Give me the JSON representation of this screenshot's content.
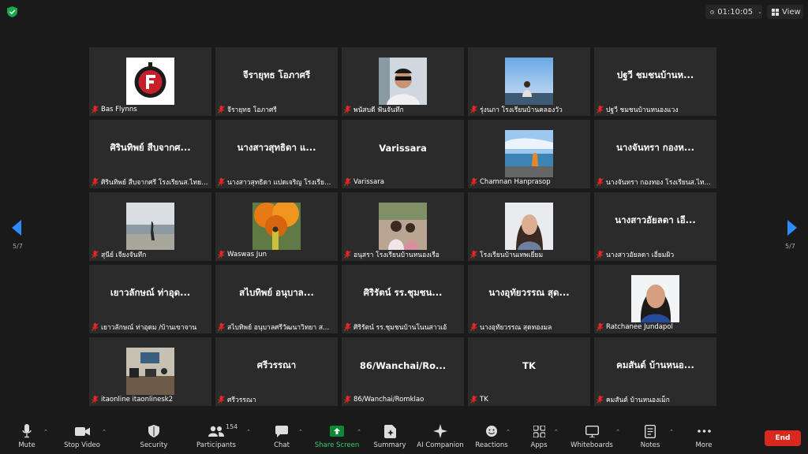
{
  "meeting": {
    "timer": "01:10:05",
    "view_label": "View",
    "page_indicator_left": "5/7",
    "page_indicator_right": "5/7",
    "accent_green": "#0e8a37",
    "mic_off_red": "#e02828"
  },
  "tiles": [
    {
      "big": "",
      "label": "Bas Flynns",
      "photo": "logo"
    },
    {
      "big": "จีรายุทธ โอภาศรี",
      "label": "จีรายุทธ โอภาศรี",
      "photo": ""
    },
    {
      "big": "",
      "label": "พนัสบดี ฟันจันทึก",
      "photo": "man"
    },
    {
      "big": "",
      "label": "รุ่งนภา โรงเรียนบ้านคลองวัว",
      "photo": "sky"
    },
    {
      "big": "ปฐวี ชมชนบ้านห...",
      "label": "ปฐวี ชมชนบ้านหนองแวง",
      "photo": ""
    },
    {
      "big": "ศิรินทิพย์ สืบจากศ...",
      "label": "ศิรินทิพย์ สืบจากศรี โรงเรียนส.ไทยเ...",
      "photo": ""
    },
    {
      "big": "นางสาวสุทธิดา แ...",
      "label": "นางสาวสุทธิดา แปดเจริญ โรงเรียน...",
      "photo": ""
    },
    {
      "big": "Varissara",
      "label": "Varissara",
      "photo": ""
    },
    {
      "big": "",
      "label": "Chamnan Hanprasop",
      "photo": "sea"
    },
    {
      "big": "นางจันทรา กองห...",
      "label": "นางจันทรา กองทอง โรงเรียนส.ไทยเ...",
      "photo": ""
    },
    {
      "big": "",
      "label": "สุนีย์ เจียงจันทึก",
      "photo": "lake"
    },
    {
      "big": "",
      "label": "Waswas Jun",
      "photo": "tree"
    },
    {
      "big": "",
      "label": "อนุสรา โรงเรียนบ้านหนองเรือ",
      "photo": "kids"
    },
    {
      "big": "",
      "label": "โรงเรียนบ้านเทพเยี่ยม",
      "photo": "woman"
    },
    {
      "big": "นางสาวอัยลดา เอี...",
      "label": "นางสาวอัยลดา เอี่ยมผิว",
      "photo": ""
    },
    {
      "big": "เยาวลักษณ์ ท่าอุด...",
      "label": "เยาวลักษณ์ ท่าอุดม /บ้านเขาจาน",
      "photo": ""
    },
    {
      "big": "สไบทิพย์ อนุบาล...",
      "label": "สไบทิพย์ อนุบาลศรีวัฒนาวิทยา ส...",
      "photo": ""
    },
    {
      "big": "ศิริรัตน์ รร.ชุมชน...",
      "label": "ศิริรัตน์ รร.ชุมชนบ้านโนนสาวเอ้",
      "photo": ""
    },
    {
      "big": "นางอุทัยวรรณ สุด...",
      "label": "นางอุทัยวรรณ สุดทองมล",
      "photo": ""
    },
    {
      "big": "",
      "label": "Ratchanee Jundapol",
      "photo": "girl"
    },
    {
      "big": "",
      "label": "itaonline itaonlinesk2",
      "photo": "office"
    },
    {
      "big": "ศรีวรรณา",
      "label": "ศรีวรรณา",
      "photo": ""
    },
    {
      "big": "86/Wanchai/Ro...",
      "label": "86/Wanchai/Romklao",
      "photo": ""
    },
    {
      "big": "TK",
      "label": "TK",
      "photo": ""
    },
    {
      "big": "คมสันต์ บ้านหนอ...",
      "label": "คมสันต์ บ้านหนองเม็ก",
      "photo": ""
    }
  ],
  "toolbar": {
    "mute": "Mute",
    "stop_video": "Stop Video",
    "security": "Security",
    "participants": "Participants",
    "participants_count": "154",
    "chat": "Chat",
    "share_screen": "Share Screen",
    "summary": "Summary",
    "ai_companion": "AI Companion",
    "reactions": "Reactions",
    "apps": "Apps",
    "whiteboards": "Whiteboards",
    "notes": "Notes",
    "more": "More",
    "end": "End"
  }
}
